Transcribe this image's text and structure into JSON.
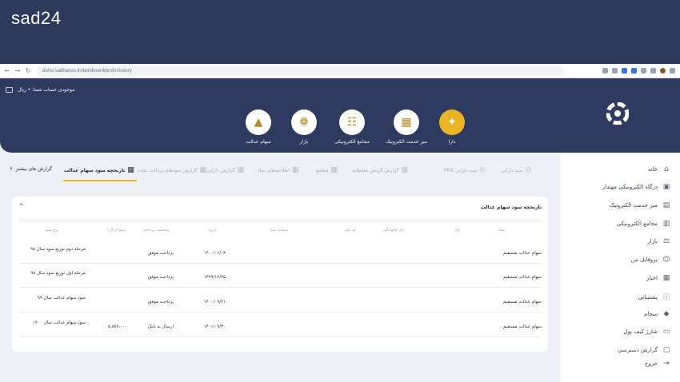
{
  "watermark": "sad24",
  "browser": {
    "url": "dshsi.sadbanoo.ir/dashboard/profit-history"
  },
  "header": {
    "balance_label": "موجودی حساب شما: • ریال",
    "quick_access": [
      {
        "label": "دارا",
        "icon": "dara-icon"
      },
      {
        "label": "میز خدمت الکترونیک",
        "icon": "service-desk-icon"
      },
      {
        "label": "مجامع الکترونیکی",
        "icon": "assemblies-icon"
      },
      {
        "label": "بازار",
        "icon": "market-icon"
      },
      {
        "label": "سهام عدالت",
        "icon": "edalat-shares-icon"
      }
    ]
  },
  "sidebar": {
    "items": [
      {
        "label": "خانه",
        "icon": "home-icon"
      },
      {
        "label": "درگاه الکترونیکی مهندار",
        "icon": "portal-icon"
      },
      {
        "label": "میز خدمت الکترونیک",
        "icon": "service-desk-icon"
      },
      {
        "label": "مجامع الکترونیکی",
        "icon": "assemblies-icon"
      },
      {
        "label": "بازار",
        "icon": "market-icon"
      },
      {
        "label": "پروفایل من",
        "icon": "profile-icon"
      },
      {
        "label": "اخبار",
        "icon": "news-icon"
      },
      {
        "label": "پشتیبانی",
        "icon": "support-icon"
      },
      {
        "label": "سجام",
        "icon": "sejam-icon"
      },
      {
        "label": "شارژ کیف پول",
        "icon": "wallet-icon"
      },
      {
        "label": "گزارش دسترسی",
        "icon": "access-report-icon"
      },
      {
        "label": "خروج",
        "icon": "logout-icon"
      }
    ]
  },
  "tabs": {
    "items": [
      {
        "label": "سبد دارایی",
        "active": false
      },
      {
        "label": "سبد دارایی PRX",
        "active": false
      },
      {
        "label": "گزارش گردش معاملات",
        "active": false
      },
      {
        "label": "مجامع",
        "active": false
      },
      {
        "label": "اطلاعیه‌های نماد",
        "active": false
      },
      {
        "label": "گزارش دارایی",
        "active": false
      },
      {
        "label": "گزارش سودهای پرداخت شده",
        "active": false
      },
      {
        "label": "تاریخچه سود سهام عدالت",
        "active": true
      }
    ],
    "more_label": "گزارش های بیشتر"
  },
  "card": {
    "title": "تاریخچه سود سهام عدالت",
    "headers": [
      "نماد",
      "نام",
      "نام خانوادگی",
      "کد ملی",
      "شماره شبا",
      "تاریخ",
      "وضعیت پرداخت",
      "مبلغ (ریال)",
      "نوع سود"
    ],
    "rows": [
      {
        "symbol": "سهام عدالت مستقیم",
        "date": "۱۴۰۰/۰۶/۰۳",
        "status": "پرداخت موفق",
        "amount": "",
        "type": "مرحله دوم توزیع سود سال ۹۸"
      },
      {
        "symbol": "سهام عدالت مستقیم",
        "date": "۱۳۹۹/۱۲/۲۵",
        "status": "پرداخت موفق",
        "amount": "",
        "type": "مرحله اول توزیع سود سال ۹۸"
      },
      {
        "symbol": "سهام عدالت مستقیم",
        "date": "۱۴۰۰/۰۹/۲۱",
        "status": "پرداخت موفق",
        "amount": "",
        "type": "سود سهام عدالت سال ۹۹"
      },
      {
        "symbol": "سهام عدالت مستقیم",
        "date": "۱۴۰۱/۰۹/۳۰",
        "status": "ارسال به بانک",
        "amount": "۸،۸۷۷،۰۰۰",
        "type": "سود سهام عدالت سال ۱۴۰۰"
      }
    ]
  }
}
